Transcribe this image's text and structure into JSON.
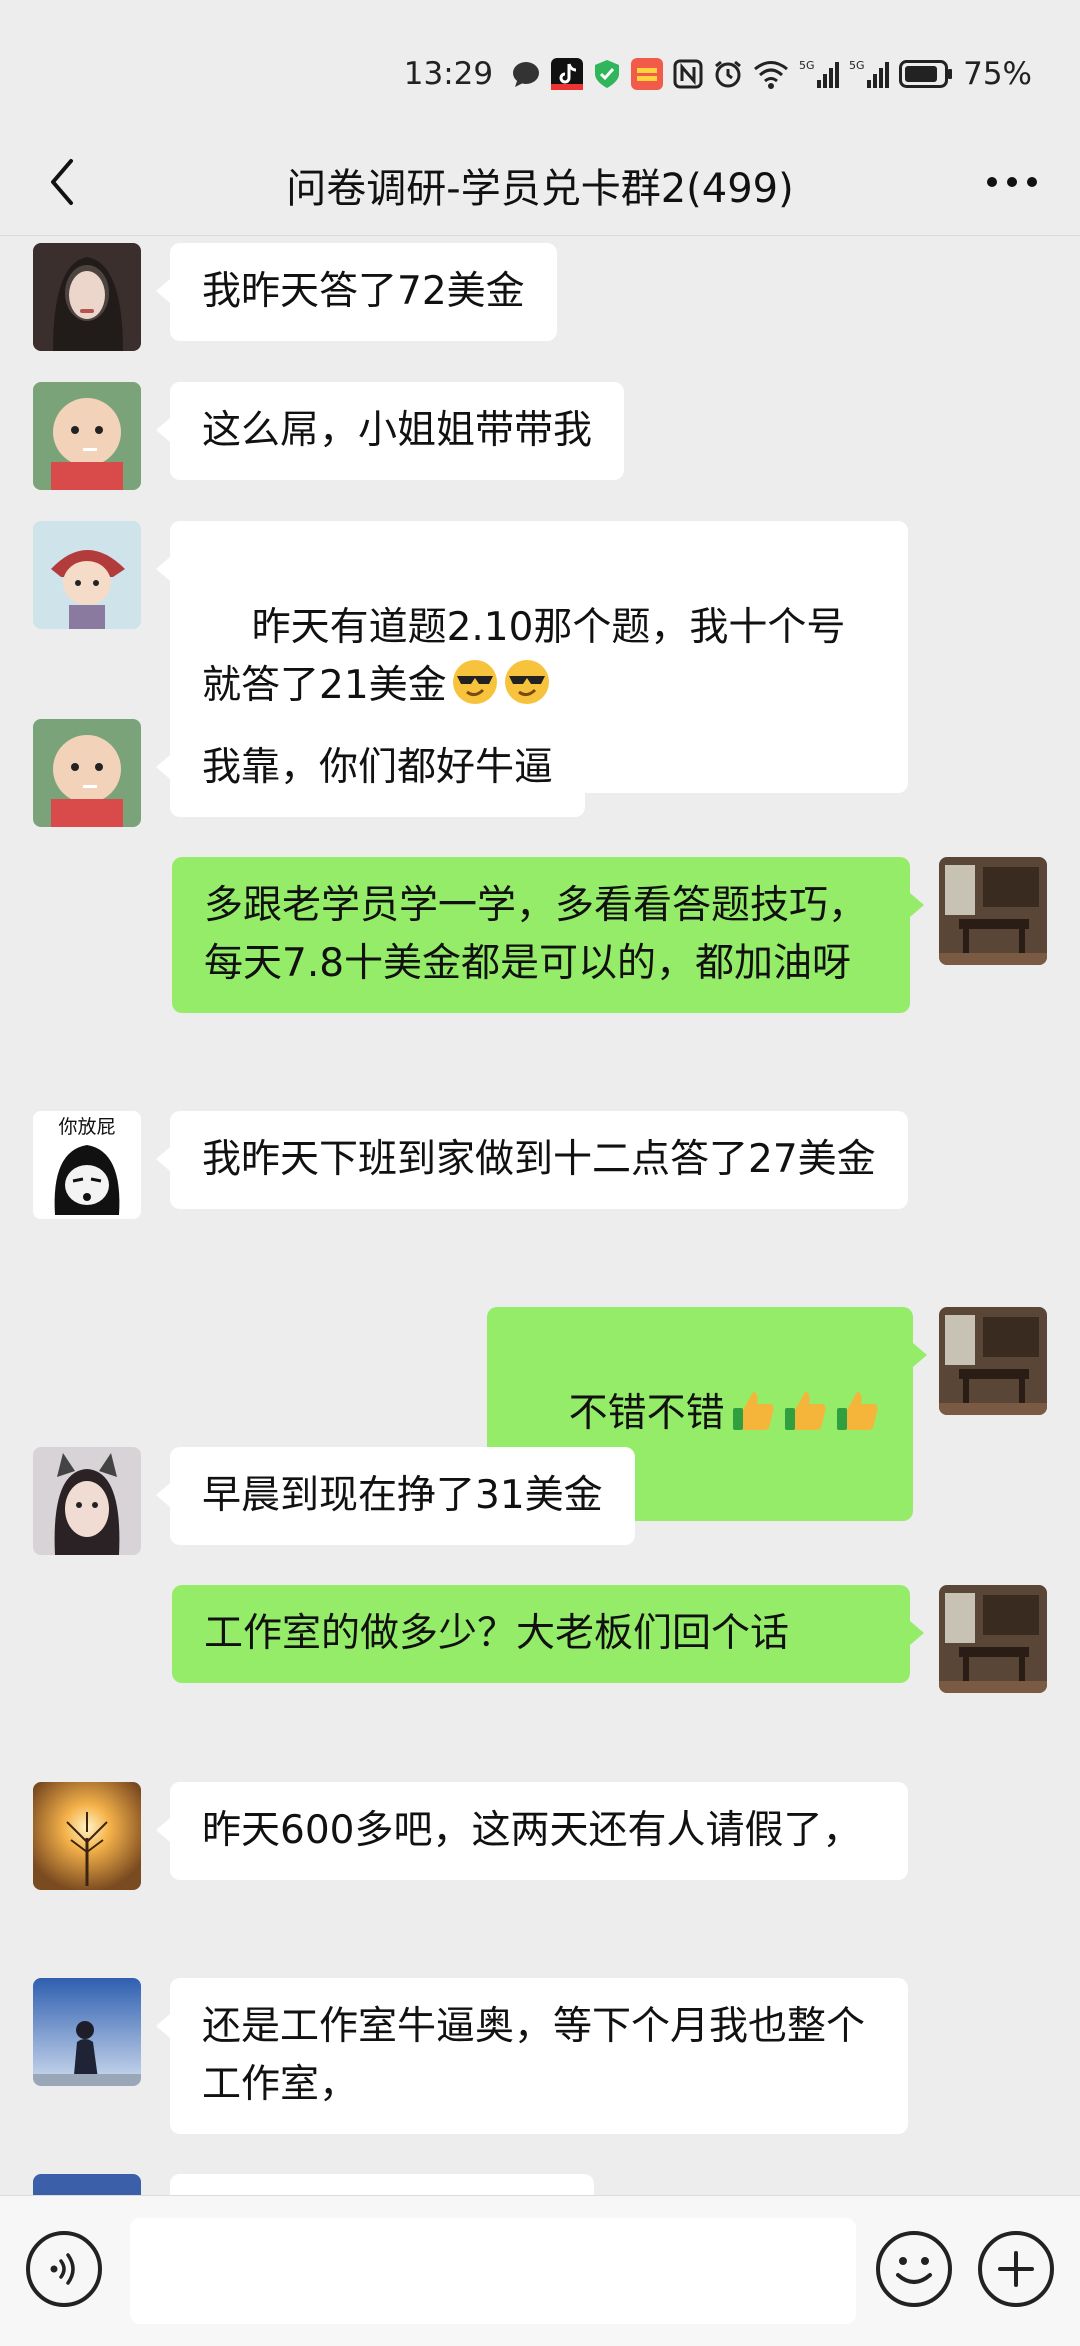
{
  "status_bar": {
    "time": "13:29",
    "battery_percent": "75%"
  },
  "nav": {
    "title": "问卷调研-学员兑卡群2(499)",
    "back_icon": "chevron-left-icon",
    "more_icon": "more-dots-icon"
  },
  "messages": [
    {
      "sender": "other",
      "avatar": "avatar-girl-dark-hair",
      "text": "我昨天答了72美金"
    },
    {
      "sender": "other",
      "avatar": "avatar-baby",
      "text": "这么屌，小姐姐带带我"
    },
    {
      "sender": "other",
      "avatar": "avatar-cartoon-boy",
      "text": "昨天有道题2.10那个题，我十个号就答了21美金"
    },
    {
      "sender": "other",
      "avatar": "avatar-baby",
      "text": "我靠，你们都好牛逼"
    },
    {
      "sender": "me",
      "avatar": "avatar-office-room",
      "text": "多跟老学员学一学，多看看答题技巧，每天7.8十美金都是可以的，都加油呀"
    },
    {
      "sender": "other",
      "avatar": "avatar-meme-face",
      "avatar_text": "你放屁",
      "text": "我昨天下班到家做到十二点答了27美金"
    },
    {
      "sender": "me",
      "avatar": "avatar-office-room",
      "text": "不错不错"
    },
    {
      "sender": "other",
      "avatar": "avatar-cat-ears-girl",
      "text": "早晨到现在挣了31美金"
    },
    {
      "sender": "me",
      "avatar": "avatar-office-room",
      "text": "工作室的做多少？大老板们回个话"
    },
    {
      "sender": "other",
      "avatar": "avatar-sunset-tree",
      "text": "昨天600多吧，这两天还有人请假了，"
    },
    {
      "sender": "other",
      "avatar": "avatar-person-sky",
      "text": "还是工作室牛逼奥，等下个月我也整个工作室，"
    }
  ],
  "input_bar": {
    "placeholder": "",
    "voice_icon": "voice-icon",
    "emoji_icon": "smiley-icon",
    "plus_icon": "plus-icon"
  },
  "colors": {
    "background": "#EDEDED",
    "bubble_other": "#FFFFFF",
    "bubble_me": "#95EC69"
  }
}
